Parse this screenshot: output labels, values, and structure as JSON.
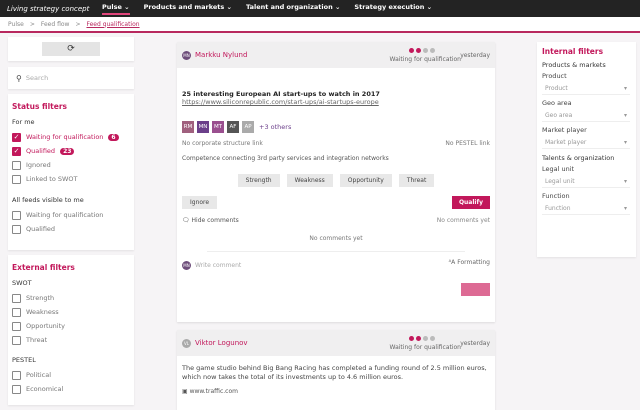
{
  "topbar": {
    "brand": "Living strategy concept",
    "nav": [
      "Pulse",
      "Products and markets",
      "Talent and organization",
      "Strategy execution"
    ]
  },
  "breadcrumb": [
    "Pulse",
    "Feed flow",
    "Feed qualification"
  ],
  "search": {
    "placeholder": "Search"
  },
  "status_filters": {
    "title": "Status filters",
    "for_me": "For me",
    "items": [
      {
        "label": "Waiting for qualification",
        "count": "6",
        "checked": true
      },
      {
        "label": "Qualified",
        "count": "23",
        "checked": true
      },
      {
        "label": "Ignored"
      },
      {
        "label": "Linked to SWOT"
      }
    ],
    "all_feeds": "All feeds visible to me",
    "all_items": [
      "Waiting for qualification",
      "Qualified"
    ]
  },
  "external_filters": {
    "title": "External filters",
    "swot": "SWOT",
    "swot_items": [
      "Strength",
      "Weakness",
      "Opportunity",
      "Threat"
    ],
    "pestel": "PESTEL",
    "pestel_items": [
      "Political",
      "Economical"
    ]
  },
  "feed1": {
    "author": "Markku Nylund",
    "initials": "MN",
    "status": "Waiting for qualification",
    "time": "yesterday",
    "title": "25 interesting European AI start-ups to watch in 2017",
    "link": "https://www.siliconrepublic.com/start-ups/ai-startups-europe",
    "avatars": [
      {
        "t": "RM",
        "c": "#a0607e"
      },
      {
        "t": "MN",
        "c": "#6b3f8a"
      },
      {
        "t": "MT",
        "c": "#9a4f8f"
      },
      {
        "t": "AF",
        "c": "#555555"
      },
      {
        "t": "AP",
        "c": "#aaaaaa"
      }
    ],
    "others": "+3 others",
    "no_corp": "No corporate structure link",
    "no_pestel": "No PESTEL link",
    "competence": "Competence connecting 3rd party services and integration networks",
    "swot_buttons": [
      "Strength",
      "Weakness",
      "Opportunity",
      "Threat"
    ],
    "ignore": "Ignore",
    "qualify": "Qualify",
    "hide_comments": "Hide comments",
    "no_comments_right": "No comments yet",
    "no_comments": "No comments yet",
    "write_comment": "Write comment",
    "formatting": "Formatting",
    "me_initials": "MN"
  },
  "feed2": {
    "author": "Viktor Logunov",
    "initials": "VL",
    "status": "Waiting for qualification",
    "time": "yesterday",
    "text": "The game studio behind Big Bang Racing has completed a funding round of 2.5 million euros, which now takes the total of its investments up to 4.6 million euros.",
    "link": "www.traffic.com"
  },
  "internal_filters": {
    "title": "Internal filters",
    "pm": "Products & markets",
    "fields1": [
      {
        "label": "Product",
        "ph": "Product"
      },
      {
        "label": "Geo area",
        "ph": "Geo area"
      },
      {
        "label": "Market player",
        "ph": "Market player"
      }
    ],
    "to": "Talents & organization",
    "fields2": [
      {
        "label": "Legal unit",
        "ph": "Legal unit"
      },
      {
        "label": "Function",
        "ph": "Function"
      }
    ]
  },
  "colors": {
    "accent": "#c2185b",
    "topbar": "#232323"
  }
}
